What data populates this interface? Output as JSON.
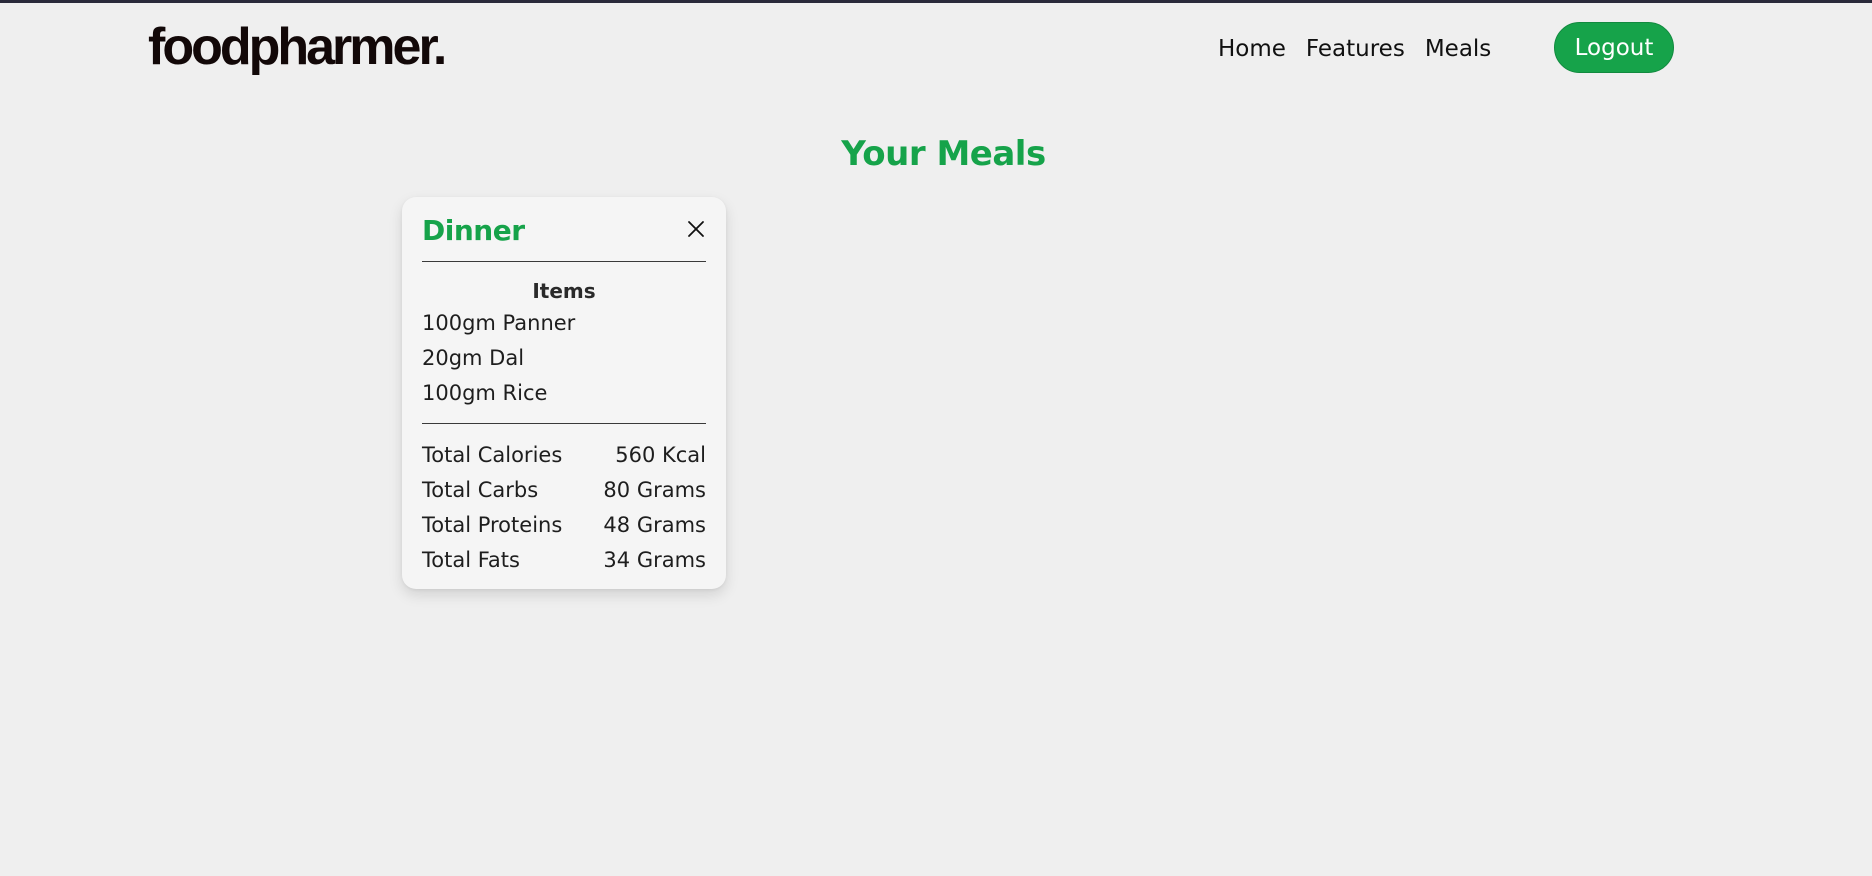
{
  "navbar": {
    "logo": "foodpharmer.",
    "links": [
      "Home",
      "Features",
      "Meals"
    ],
    "logout_label": "Logout"
  },
  "page": {
    "title": "Your Meals"
  },
  "meal_card": {
    "title": "Dinner",
    "items_heading": "Items",
    "items": [
      "100gm Panner",
      "20gm Dal",
      "100gm Rice"
    ],
    "totals": [
      {
        "label": "Total Calories",
        "value": "560 Kcal"
      },
      {
        "label": "Total Carbs",
        "value": "80 Grams"
      },
      {
        "label": "Total Proteins",
        "value": "48 Grams"
      },
      {
        "label": "Total Fats",
        "value": "34 Grams"
      }
    ]
  },
  "colors": {
    "accent": "#16a34a",
    "background": "#efefef",
    "card": "#f5f5f5"
  }
}
